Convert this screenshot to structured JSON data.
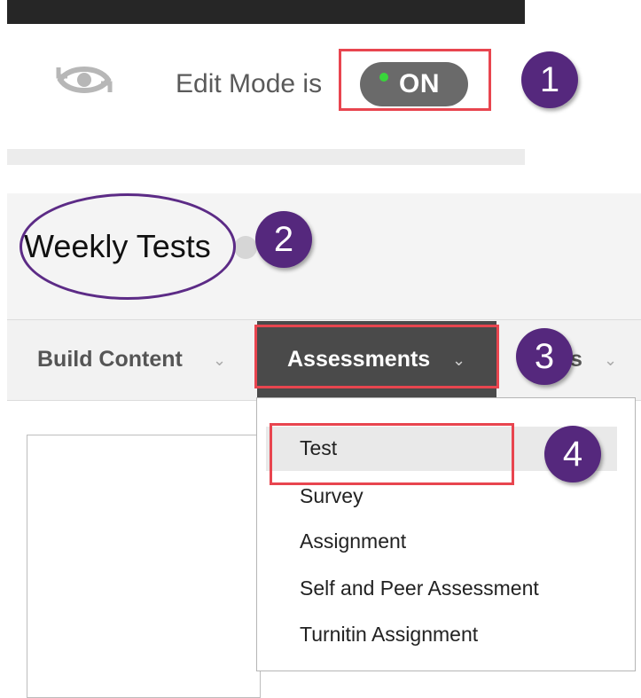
{
  "edit_mode": {
    "label": "Edit Mode is",
    "toggle_state": "ON",
    "toggle_dot_color": "#39d53b",
    "icon": "eye-refresh-icon"
  },
  "page": {
    "title": "Weekly Tests"
  },
  "action_bar": {
    "build_content_label": "Build Content",
    "assessments_label": "Assessments",
    "tools_label_visible": "ls",
    "chevron": "⌄"
  },
  "assessments_menu": {
    "items": [
      "Test",
      "Survey",
      "Assignment",
      "Self and Peer Assessment",
      "Turnitin Assignment"
    ]
  },
  "annotations": {
    "badges": [
      "1",
      "2",
      "3",
      "4"
    ],
    "badge_color": "#55287d",
    "highlight_color": "#e8454f"
  }
}
